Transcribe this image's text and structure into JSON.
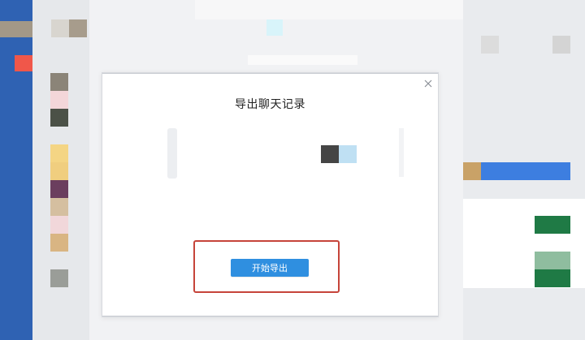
{
  "dialog": {
    "title": "导出聊天记录",
    "start_export_label": "开始导出",
    "close_glyph": "×"
  },
  "colors": {
    "accent": "#2f8fe0",
    "highlight_border": "#c6443a",
    "left_rail": "#2f62b3"
  },
  "icons": {
    "close": "close-icon"
  }
}
